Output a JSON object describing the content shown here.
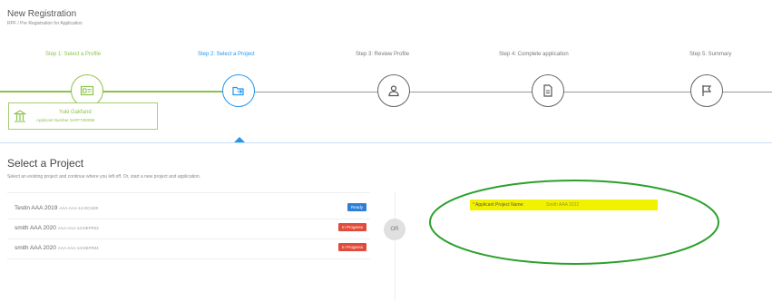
{
  "header": {
    "title": "New Registration",
    "subtitle": "RPF / Pre Registration for Application"
  },
  "steps": [
    {
      "label": "Step 1: Select a Profile",
      "state": "done",
      "icon": "id-card-icon"
    },
    {
      "label": "Step 2: Select a Project",
      "state": "active",
      "icon": "folder-arrow-icon"
    },
    {
      "label": "Step 3: Review Profile",
      "state": "pending",
      "icon": "person-icon"
    },
    {
      "label": "Step 4: Complete application",
      "state": "pending",
      "icon": "document-icon"
    },
    {
      "label": "Step 5: Summary",
      "state": "pending",
      "icon": "flag-icon"
    }
  ],
  "profile_card": {
    "name": "Yuki Gakfand",
    "number": "Applicant Number 0AFF73000M",
    "icon": "building-icon"
  },
  "section": {
    "title": "Select a Project",
    "description": "Select an existing project and continue where you left off. Or, start a new project and application."
  },
  "projects": [
    {
      "name": "Testin AAA 2019",
      "id": "AAA-AAA-14-DCI420",
      "badge": "Ready",
      "badge_color": "#2f7fd6"
    },
    {
      "name": "smith AAA 2020",
      "id": "AAA-AAA-14-DEFR03",
      "badge": "In Progress",
      "badge_color": "#e24a3a"
    },
    {
      "name": "smith AAA 2020",
      "id": "AAA-AAA-14-DEFR04",
      "badge": "In Progress",
      "badge_color": "#e24a3a"
    }
  ],
  "or_text": "OR",
  "applicant_project": {
    "label": "* Applicant Project Name:",
    "value": "Smith AAA 2022"
  },
  "colors": {
    "done": "#8bc34a",
    "active": "#2196f3",
    "highlight": "#f2f200",
    "annotation": "#2ca02c"
  }
}
